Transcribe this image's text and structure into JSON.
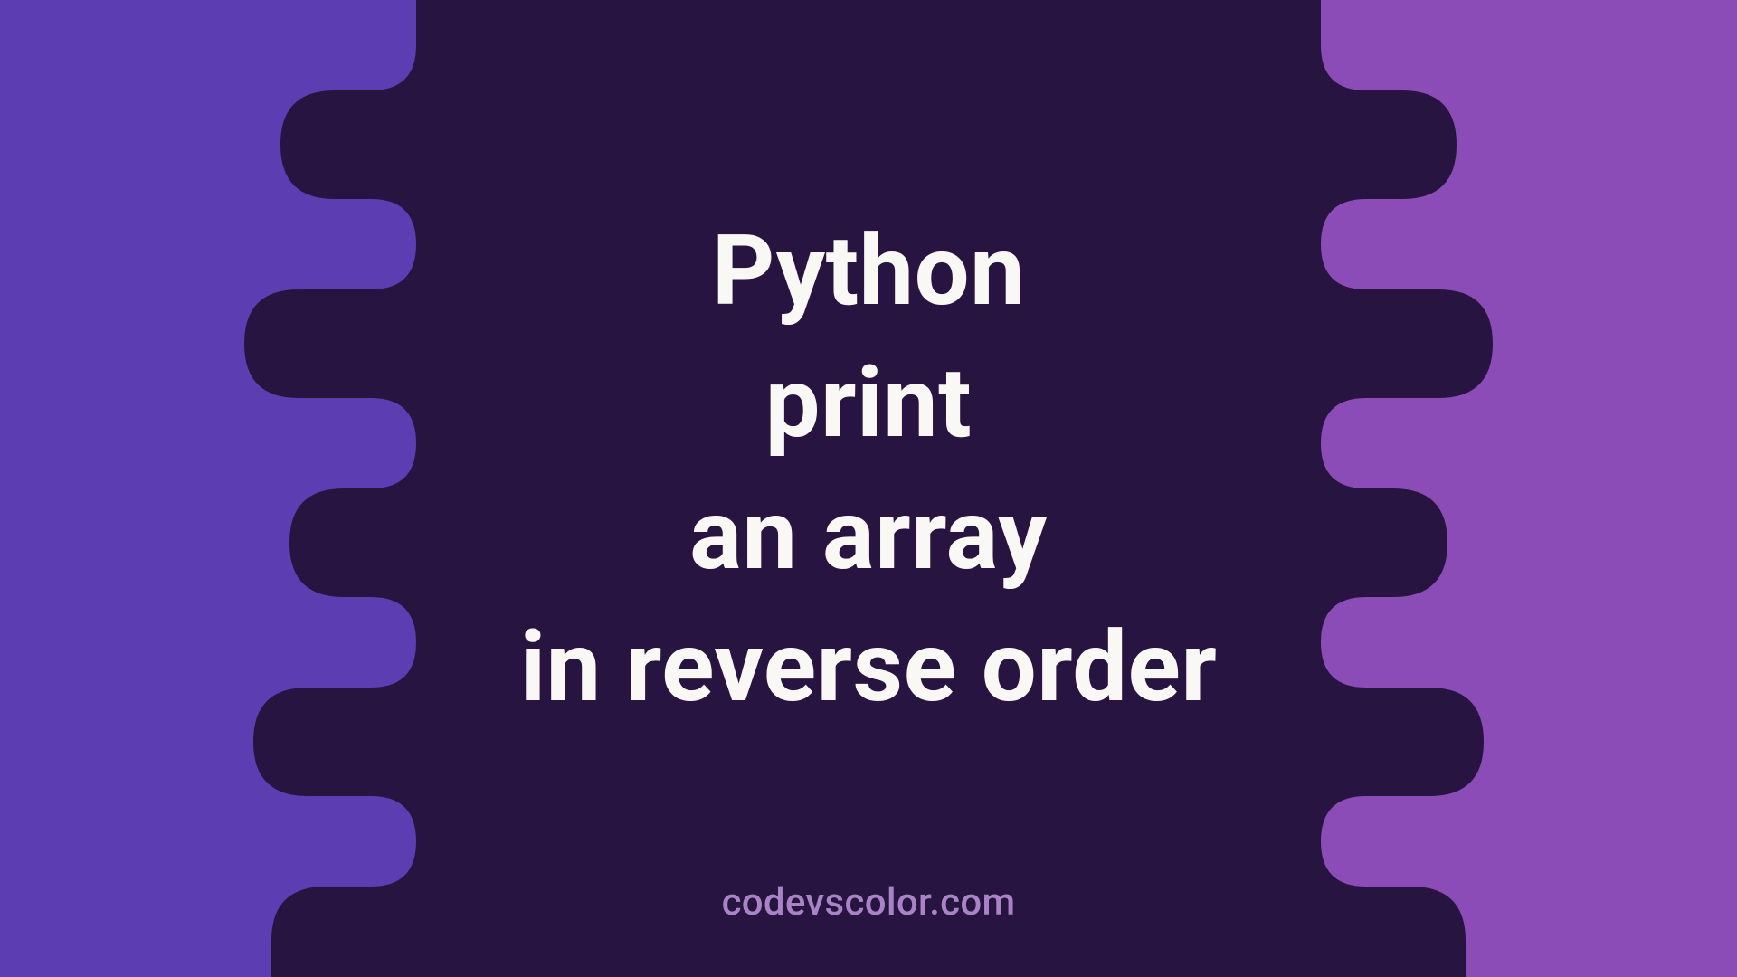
{
  "title": {
    "line1": "Python",
    "line2": "print",
    "line3": "an array",
    "line4": "in reverse order"
  },
  "credit": "codevscolor.com",
  "colors": {
    "left_panel": "#5C3DB2",
    "right_panel": "#8C4CB8",
    "blob": "#271440",
    "title_text": "#FAF8F5",
    "credit_text": "#A884C6"
  }
}
